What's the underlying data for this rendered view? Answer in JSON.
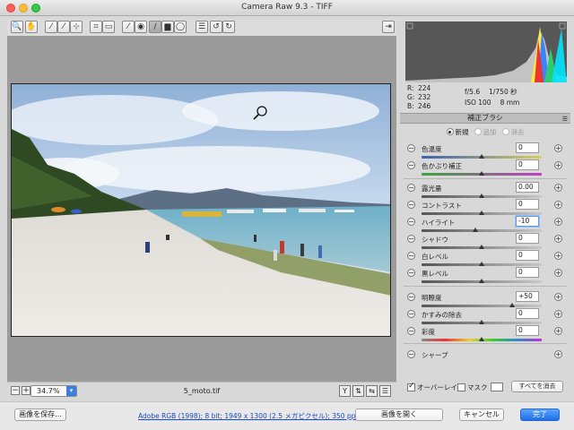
{
  "window": {
    "title": "Camera Raw 9.3  -  TIFF"
  },
  "toolbar": {
    "tools": [
      {
        "name": "zoom-tool-icon",
        "glyph": "🔍"
      },
      {
        "name": "hand-tool-icon",
        "glyph": "✋"
      },
      {
        "name": "white-balance-tool-icon",
        "glyph": "⁄"
      },
      {
        "name": "color-sampler-tool-icon",
        "glyph": "⁄"
      },
      {
        "name": "targeted-adjustment-tool-icon",
        "glyph": "⊹"
      },
      {
        "name": "crop-tool-icon",
        "glyph": "⌗"
      },
      {
        "name": "straighten-tool-icon",
        "glyph": "▭"
      },
      {
        "name": "spot-removal-tool-icon",
        "glyph": "⁄"
      },
      {
        "name": "red-eye-tool-icon",
        "glyph": "◉"
      },
      {
        "name": "adjustment-brush-tool-icon",
        "glyph": "/"
      },
      {
        "name": "graduated-filter-tool-icon",
        "glyph": "▆"
      },
      {
        "name": "radial-filter-tool-icon",
        "glyph": "◯"
      },
      {
        "name": "preferences-icon",
        "glyph": "☰"
      },
      {
        "name": "rotate-left-icon",
        "glyph": "↺"
      },
      {
        "name": "rotate-right-icon",
        "glyph": "↻"
      }
    ],
    "fullscreen_glyph": "⇥"
  },
  "histogram": {
    "r": "224",
    "g": "232",
    "b": "246",
    "r_label": "R:",
    "g_label": "G:",
    "b_label": "B:",
    "aperture": "f/5.6",
    "shutter": "1/750 秒",
    "iso": "ISO 100",
    "focal": "8 mm"
  },
  "panel": {
    "title": "補正ブラシ",
    "modes": [
      {
        "label": "新規",
        "selected": true
      },
      {
        "label": "追加",
        "selected": false
      },
      {
        "label": "消去",
        "selected": false
      }
    ],
    "sliders": [
      {
        "label": "色温度",
        "value": "0",
        "pos": 0.5,
        "track": "temp"
      },
      {
        "label": "色かぶり補正",
        "value": "0",
        "pos": 0.5,
        "track": "tint"
      },
      {
        "label": "露光量",
        "value": "0.00",
        "pos": 0.5,
        "track": "plain"
      },
      {
        "label": "コントラスト",
        "value": "0",
        "pos": 0.5,
        "track": "plain"
      },
      {
        "label": "ハイライト",
        "value": "-10",
        "pos": 0.45,
        "track": "plain",
        "focus": true
      },
      {
        "label": "シャドウ",
        "value": "0",
        "pos": 0.5,
        "track": "plain"
      },
      {
        "label": "白レベル",
        "value": "0",
        "pos": 0.5,
        "track": "plain"
      },
      {
        "label": "黒レベル",
        "value": "0",
        "pos": 0.5,
        "track": "plain"
      },
      {
        "label": "明瞭度",
        "value": "+50",
        "pos": 0.75,
        "track": "plain"
      },
      {
        "label": "かすみの除去",
        "value": "0",
        "pos": 0.5,
        "track": "plain"
      },
      {
        "label": "彩度",
        "value": "0",
        "pos": 0.5,
        "track": "sat"
      },
      {
        "label": "シャープ",
        "value": "",
        "pos": 0.5,
        "track": "plain"
      }
    ],
    "overlay_label": "オーバーレイ",
    "mask_label": "マスク",
    "clear_all": "すべてを消去"
  },
  "status": {
    "zoom": "34.7%",
    "filename": "5_moto.tif",
    "minus": "−",
    "plus": "+"
  },
  "bottom": {
    "save": "画像を保存...",
    "workflow": "Adobe RGB (1998); 8 bit; 1949 x 1300 (2.5 メガピクセル); 350 ppi",
    "open": "画像を開く",
    "cancel": "キャンセル",
    "done": "完了"
  },
  "colors": {
    "accent": "#1e6fe8",
    "link": "#1a49c9"
  }
}
